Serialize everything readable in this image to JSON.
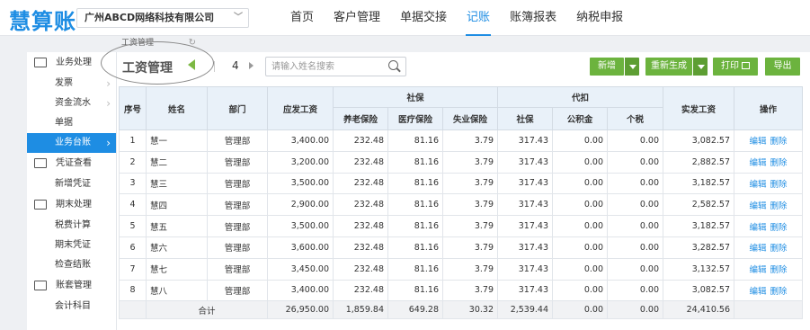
{
  "header": {
    "logo": "慧算账",
    "company": "广州ABCD网络科技有限公司",
    "nav": [
      "首页",
      "客户管理",
      "单据交接",
      "记账",
      "账簿报表",
      "纳税申报"
    ],
    "active_nav": "记账"
  },
  "tab": {
    "label": "工资管理"
  },
  "sidebar": {
    "groups": [
      {
        "label": "业务处理",
        "icon": "ledger-icon",
        "items": [
          {
            "label": "发票",
            "chevron": true
          },
          {
            "label": "资金流水",
            "chevron": true
          },
          {
            "label": "单据"
          },
          {
            "label": "业务台账",
            "chevron": true,
            "active": true
          }
        ]
      },
      {
        "label": "凭证查看",
        "icon": "table-icon",
        "items": [
          {
            "label": "新增凭证"
          }
        ]
      },
      {
        "label": "期末处理",
        "icon": "folder-icon",
        "items": [
          {
            "label": "税费计算"
          },
          {
            "label": "期末凭证"
          },
          {
            "label": "检查结账"
          }
        ]
      },
      {
        "label": "账套管理",
        "icon": "card-icon",
        "items": [
          {
            "label": "会计科目"
          }
        ]
      }
    ]
  },
  "toolbar": {
    "title": "工资管理",
    "page": "4",
    "search_placeholder": "请输入姓名搜索",
    "buttons": {
      "add": "新增",
      "regenerate": "重新生成",
      "print": "打印",
      "export": "导出"
    }
  },
  "table": {
    "headers": {
      "seq": "序号",
      "name": "姓名",
      "dept": "部门",
      "gross": "应发工资",
      "social": "社保",
      "pension": "养老保险",
      "medical": "医疗保险",
      "unemployment": "失业保险",
      "withhold": "代扣",
      "w_social": "社保",
      "w_fund": "公积金",
      "w_tax": "个税",
      "net": "实发工资",
      "ops": "操作"
    },
    "rows": [
      [
        "1",
        "慧一",
        "管理部",
        "3,400.00",
        "232.48",
        "81.16",
        "3.79",
        "317.43",
        "0.00",
        "0.00",
        "3,082.57"
      ],
      [
        "2",
        "慧二",
        "管理部",
        "3,200.00",
        "232.48",
        "81.16",
        "3.79",
        "317.43",
        "0.00",
        "0.00",
        "2,882.57"
      ],
      [
        "3",
        "慧三",
        "管理部",
        "3,500.00",
        "232.48",
        "81.16",
        "3.79",
        "317.43",
        "0.00",
        "0.00",
        "3,182.57"
      ],
      [
        "4",
        "慧四",
        "管理部",
        "2,900.00",
        "232.48",
        "81.16",
        "3.79",
        "317.43",
        "0.00",
        "0.00",
        "2,582.57"
      ],
      [
        "5",
        "慧五",
        "管理部",
        "3,500.00",
        "232.48",
        "81.16",
        "3.79",
        "317.43",
        "0.00",
        "0.00",
        "3,182.57"
      ],
      [
        "6",
        "慧六",
        "管理部",
        "3,600.00",
        "232.48",
        "81.16",
        "3.79",
        "317.43",
        "0.00",
        "0.00",
        "3,282.57"
      ],
      [
        "7",
        "慧七",
        "管理部",
        "3,450.00",
        "232.48",
        "81.16",
        "3.79",
        "317.43",
        "0.00",
        "0.00",
        "3,132.57"
      ],
      [
        "8",
        "慧八",
        "管理部",
        "3,400.00",
        "232.48",
        "81.16",
        "3.79",
        "317.43",
        "0.00",
        "0.00",
        "3,082.57"
      ]
    ],
    "ops": {
      "edit": "编辑",
      "delete": "删除"
    },
    "total": {
      "label": "合计",
      "values": [
        "26,950.00",
        "1,859.84",
        "649.28",
        "30.32",
        "2,539.44",
        "0.00",
        "0.00",
        "24,410.56"
      ]
    }
  },
  "colors": {
    "brand": "#1e8de3",
    "button_green": "#6cb33e"
  }
}
